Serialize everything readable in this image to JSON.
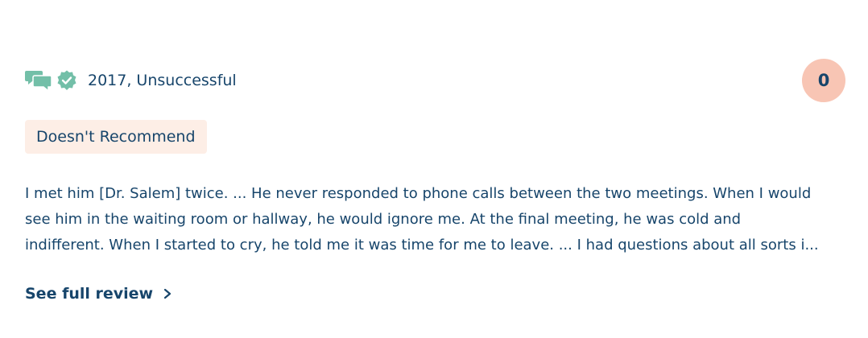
{
  "review": {
    "meta": "2017, Unsuccessful",
    "score": "0",
    "badge": "Doesn't Recommend",
    "lines": [
      "I met him [Dr. Salem] twice. ... He never responded to phone calls between the two meetings. When I would",
      "see him in the waiting room or hallway, he would ignore me. At the final meeting, he was cold and",
      "indifferent. When I started to cry, he told me it was time for me to leave. ... I had questions about all sorts i..."
    ],
    "see_full_label": "See full review"
  },
  "icons": {
    "chat": "chat-bubbles-icon",
    "verified": "verified-badge-icon",
    "chevron": "chevron-right-icon"
  },
  "colors": {
    "text": "#17456b",
    "accent_green": "#73bfa8",
    "score_bg": "#f8c5b4",
    "badge_bg": "#fdeee6"
  }
}
